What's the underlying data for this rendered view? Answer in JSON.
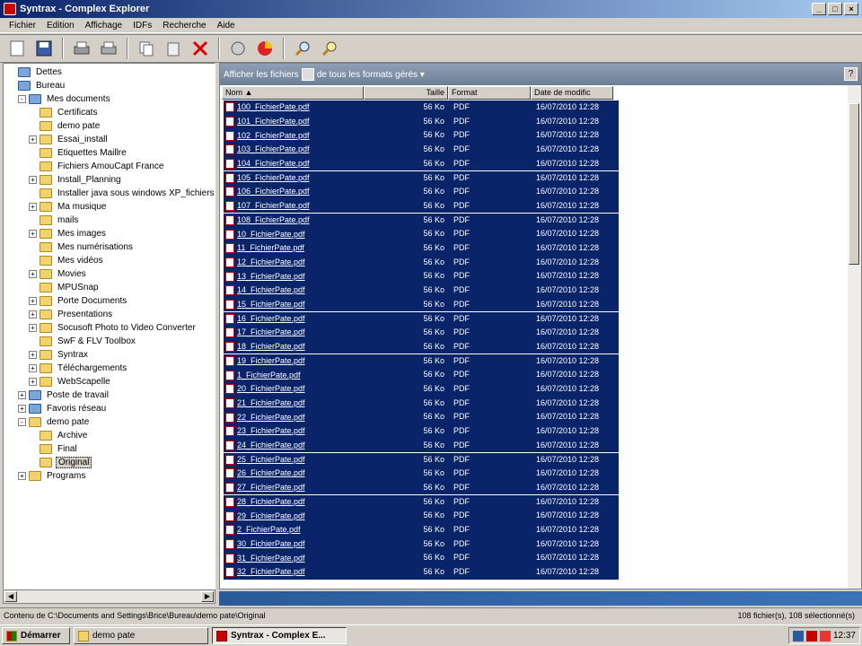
{
  "window": {
    "title": "Syntrax - Complex Explorer",
    "buttons": [
      "_",
      "□",
      "×"
    ]
  },
  "menu": [
    "Fichier",
    "Edition",
    "Affichage",
    "IDFs",
    "Recherche",
    "Aide"
  ],
  "toolbar": [
    "new-icon",
    "save-icon",
    "print-icon",
    "print-preview-icon",
    "copy-icon",
    "paste-icon",
    "delete-icon",
    "refresh-icon",
    "pie-icon",
    "search-icon",
    "zoom-icon"
  ],
  "tree": [
    {
      "label": "Dettes",
      "level": 0,
      "exp": "",
      "kind": "sys"
    },
    {
      "label": "Bureau",
      "level": 0,
      "exp": "",
      "kind": "sys"
    },
    {
      "label": "Mes documents",
      "level": 1,
      "exp": "-",
      "kind": "sys"
    },
    {
      "label": "Certificats",
      "level": 2,
      "exp": "",
      "kind": "folder"
    },
    {
      "label": "demo pate",
      "level": 2,
      "exp": "",
      "kind": "folder"
    },
    {
      "label": "Essai_install",
      "level": 2,
      "exp": "+",
      "kind": "folder"
    },
    {
      "label": "Etiquettes Maillre",
      "level": 2,
      "exp": "",
      "kind": "folder"
    },
    {
      "label": "Fichiers AmouCapt France",
      "level": 2,
      "exp": "",
      "kind": "folder"
    },
    {
      "label": "Install_Planning",
      "level": 2,
      "exp": "+",
      "kind": "folder"
    },
    {
      "label": "Installer java sous windows XP_fichiers",
      "level": 2,
      "exp": "",
      "kind": "folder"
    },
    {
      "label": "Ma musique",
      "level": 2,
      "exp": "+",
      "kind": "folder"
    },
    {
      "label": "mails",
      "level": 2,
      "exp": "",
      "kind": "folder"
    },
    {
      "label": "Mes images",
      "level": 2,
      "exp": "+",
      "kind": "folder"
    },
    {
      "label": "Mes numérisations",
      "level": 2,
      "exp": "",
      "kind": "folder"
    },
    {
      "label": "Mes vidéos",
      "level": 2,
      "exp": "",
      "kind": "folder"
    },
    {
      "label": "Movies",
      "level": 2,
      "exp": "+",
      "kind": "folder"
    },
    {
      "label": "MPUSnap",
      "level": 2,
      "exp": "",
      "kind": "folder"
    },
    {
      "label": "Porte Documents",
      "level": 2,
      "exp": "+",
      "kind": "folder"
    },
    {
      "label": "Presentations",
      "level": 2,
      "exp": "+",
      "kind": "folder"
    },
    {
      "label": "Socusoft Photo to Video Converter",
      "level": 2,
      "exp": "+",
      "kind": "folder"
    },
    {
      "label": "SwF & FLV Toolbox",
      "level": 2,
      "exp": "",
      "kind": "folder"
    },
    {
      "label": "Syntrax",
      "level": 2,
      "exp": "+",
      "kind": "folder"
    },
    {
      "label": "Téléchargements",
      "level": 2,
      "exp": "+",
      "kind": "folder"
    },
    {
      "label": "WebScapelle",
      "level": 2,
      "exp": "+",
      "kind": "folder"
    },
    {
      "label": "Poste de travail",
      "level": 1,
      "exp": "+",
      "kind": "sys"
    },
    {
      "label": "Favoris réseau",
      "level": 1,
      "exp": "+",
      "kind": "sys"
    },
    {
      "label": "demo pate",
      "level": 1,
      "exp": "-",
      "kind": "folder"
    },
    {
      "label": "Archive",
      "level": 2,
      "exp": "",
      "kind": "folder"
    },
    {
      "label": "Final",
      "level": 2,
      "exp": "",
      "kind": "folder"
    },
    {
      "label": "Original",
      "level": 2,
      "exp": "",
      "kind": "folder",
      "selected": true
    },
    {
      "label": "Programs",
      "level": 1,
      "exp": "+",
      "kind": "folder"
    }
  ],
  "filter": {
    "prefix": "Afficher les fichiers",
    "suffix": "de tous les formats gérés ▾"
  },
  "columns": [
    "Nom",
    "Taille",
    "Format",
    "Date de modific"
  ],
  "files": [
    "100_FichierPate.pdf",
    "101_FichierPate.pdf",
    "102_FichierPate.pdf",
    "103_FichierPate.pdf",
    "104_FichierPate.pdf",
    "105_FichierPate.pdf",
    "106_FichierPate.pdf",
    "107_FichierPate.pdf",
    "108_FichierPate.pdf",
    "10_FichierPate.pdf",
    "11_FichierPate.pdf",
    "12_FichierPate.pdf",
    "13_FichierPate.pdf",
    "14_FichierPate.pdf",
    "15_FichierPate.pdf",
    "16_FichierPate.pdf",
    "17_FichierPate.pdf",
    "18_FichierPate.pdf",
    "19_FichierPate.pdf",
    "1_FichierPate.pdf",
    "20_FichierPate.pdf",
    "21_FichierPate.pdf",
    "22_FichierPate.pdf",
    "23_FichierPate.pdf",
    "24_FichierPate.pdf",
    "25_FichierPate.pdf",
    "26_FichierPate.pdf",
    "27_FichierPate.pdf",
    "28_FichierPate.pdf",
    "29_FichierPate.pdf",
    "2_FichierPate.pdf",
    "30_FichierPate.pdf",
    "31_FichierPate.pdf",
    "32_FichierPate.pdf"
  ],
  "file_size": "56 Ko",
  "file_format": "PDF",
  "file_date": "16/07/2010 12:28",
  "status": {
    "path": "Contenu de C:\\Documents and Settings\\Brice\\Bureau\\demo pate\\Original",
    "count": "108 fichier(s), 108 sélectionné(s)"
  },
  "taskbar": {
    "start": "Démarrer",
    "items": [
      "demo pate",
      "Syntrax - Complex E..."
    ],
    "clock": "12:37"
  }
}
